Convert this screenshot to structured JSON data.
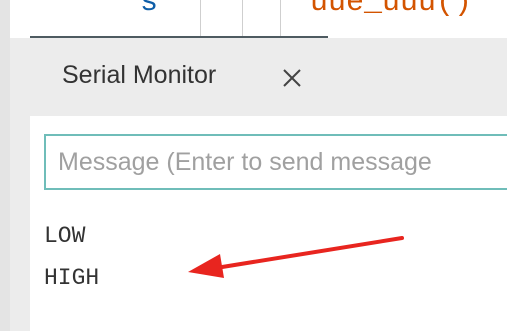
{
  "editor": {
    "code_left": "  s",
    "code_right": "uue_uuu()"
  },
  "serial_monitor": {
    "tab_label": "Serial Monitor",
    "close_icon": "close-icon",
    "message_placeholder": "Message (Enter to send message",
    "output_lines": [
      "LOW",
      "HIGH"
    ],
    "border_color": "#6fbdb9"
  },
  "annotation": {
    "arrow_color": "#e8251f",
    "arrow_icon": "red-arrow-pointer"
  }
}
